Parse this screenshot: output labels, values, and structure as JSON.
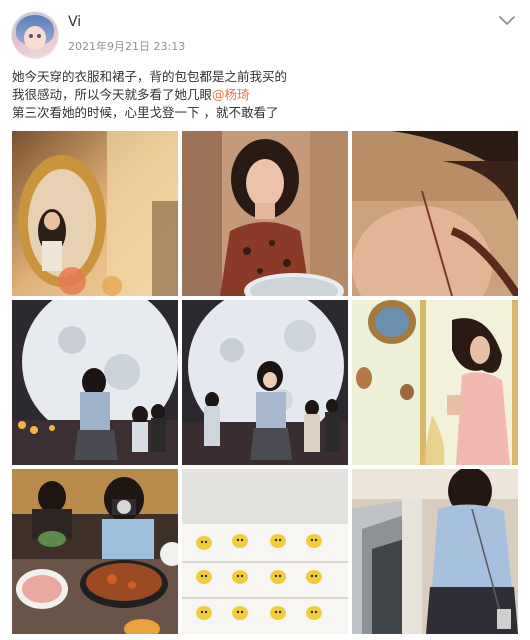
{
  "post": {
    "username": "Vi",
    "timestamp": "2021年9月21日 23:13",
    "menu_icon": "chevron-down-icon",
    "text_lines": [
      {
        "text": "她今天穿的衣服和裙子，背的包包都是之前我买的"
      },
      {
        "text": "我很感动，所以今天就多看了她几眼",
        "mention": "@杨琦"
      },
      {
        "text": "第三次看她的时候，心里戈登一下 ，就不敢看了"
      }
    ]
  },
  "photos": [
    {
      "name": "photo-mirror-selfie"
    },
    {
      "name": "photo-portrait-leopard-dress"
    },
    {
      "name": "photo-shoulder-closeup"
    },
    {
      "name": "photo-moon-lamp-back"
    },
    {
      "name": "photo-moon-lamp-front"
    },
    {
      "name": "photo-vintage-wall"
    },
    {
      "name": "photo-restaurant-camera"
    },
    {
      "name": "photo-pikachu-pattern"
    },
    {
      "name": "photo-escalator"
    }
  ],
  "colors": {
    "mention": "#eb7350",
    "timestamp": "#939393",
    "text": "#333333"
  }
}
